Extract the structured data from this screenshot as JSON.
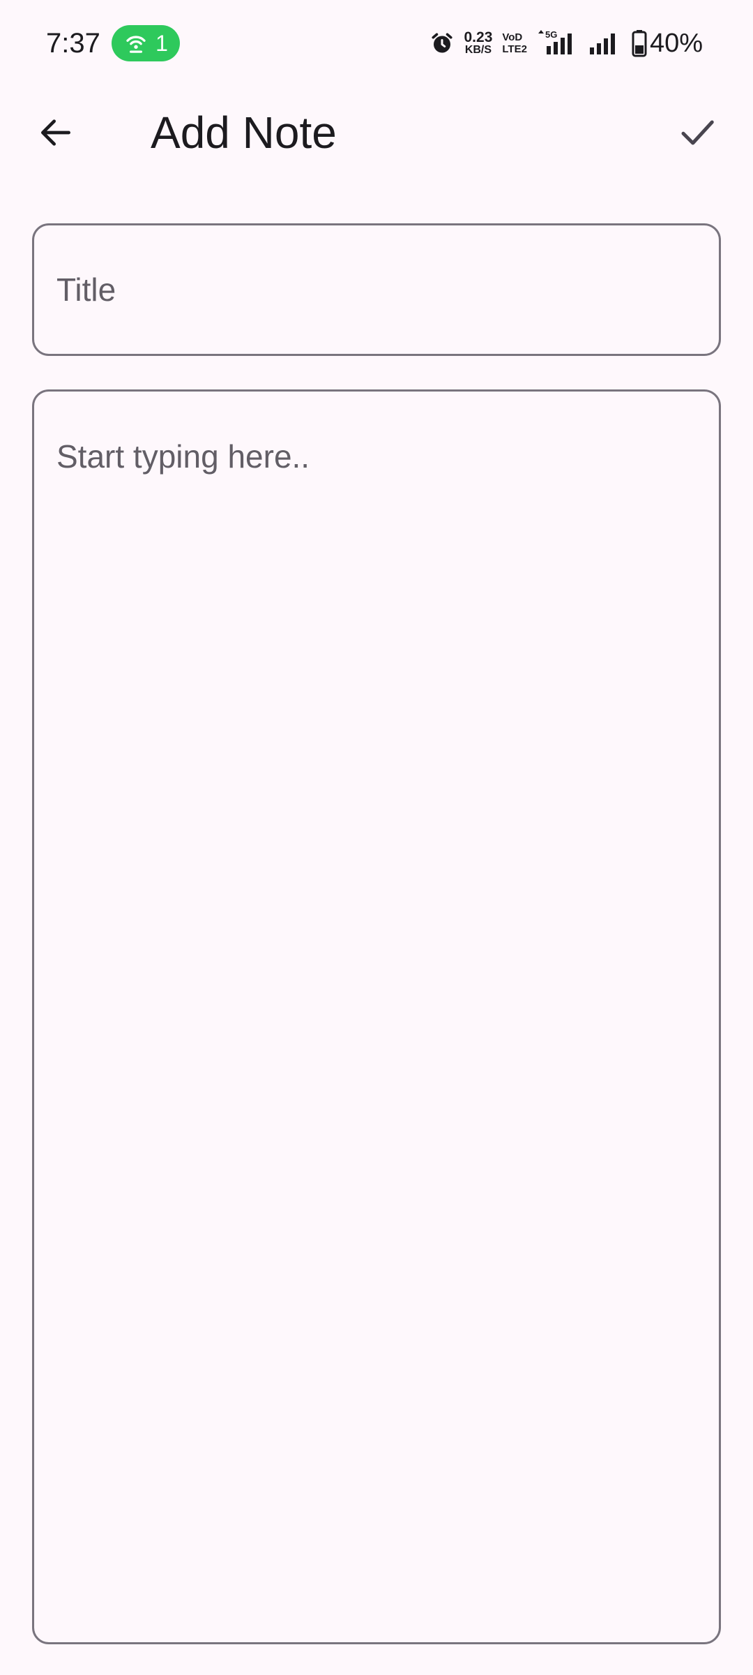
{
  "status_bar": {
    "time": "7:37",
    "hotspot_count": "1",
    "net_speed_value": "0.23",
    "net_speed_unit": "KB/S",
    "volte_top": "VoD",
    "volte_bottom": "LTE2",
    "network_type": "5G",
    "battery_percent": "40%",
    "battery_level": 0.4,
    "hotspot_color": "#2ec95c"
  },
  "app_bar": {
    "title": "Add Note",
    "back_icon": "arrow-back-icon",
    "save_icon": "check-icon"
  },
  "form": {
    "title_placeholder": "Title",
    "title_value": "",
    "body_placeholder": "Start typing here..",
    "body_value": ""
  }
}
